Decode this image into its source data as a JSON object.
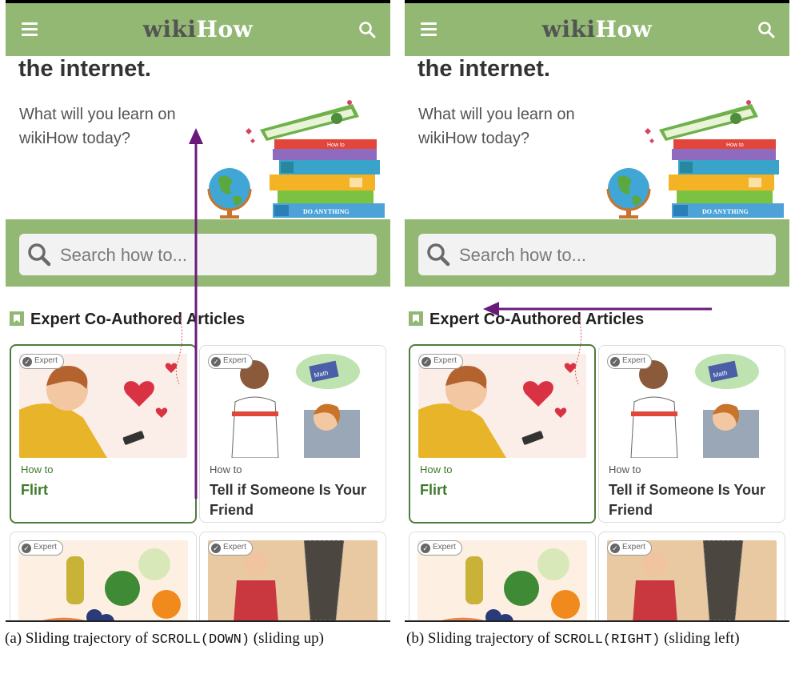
{
  "app": {
    "logo_part1": "wiki",
    "logo_part2": "How"
  },
  "hero": {
    "title": "the internet.",
    "subtitle": "What will you learn on wikiHow today?",
    "illustration_book_labels": [
      "How to",
      "DO ANYTHING",
      "HOW TO"
    ]
  },
  "search": {
    "placeholder": "Search how to..."
  },
  "section": {
    "title": "Expert Co-Authored Articles"
  },
  "cards": [
    {
      "badge": "Expert",
      "howto": "How to",
      "title": "Flirt"
    },
    {
      "badge": "Expert",
      "howto": "How to",
      "title": "Tell if Someone Is Your Friend",
      "image_label": "Math"
    },
    {
      "badge": "Expert"
    },
    {
      "badge": "Expert"
    }
  ],
  "captions": {
    "a_prefix": "(a) Sliding trajectory of ",
    "a_action": "SCROLL(DOWN)",
    "a_suffix": " (sliding up)",
    "b_prefix": "(b) Sliding trajectory of ",
    "b_action": "SCROLL(RIGHT)",
    "b_suffix": " (sliding left)"
  },
  "colors": {
    "brand_green": "#93b874",
    "selected_border": "#4e7c3a",
    "selected_text": "#3d7a2a",
    "trajectory": "#6a1b7a"
  },
  "icons": [
    "menu-icon",
    "search-icon",
    "bookmark-icon",
    "checkmark-icon"
  ]
}
